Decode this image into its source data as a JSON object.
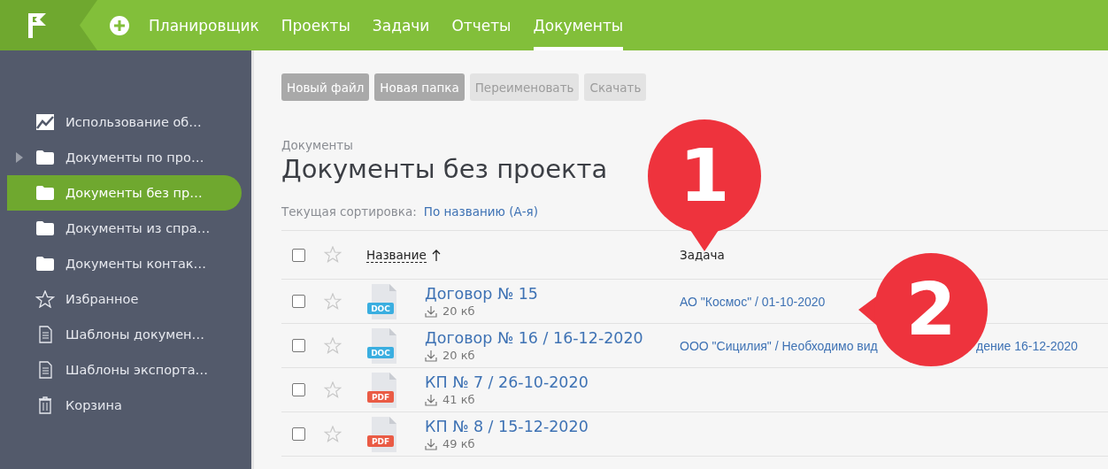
{
  "nav": {
    "items": [
      {
        "label": "Планировщик",
        "selected": false
      },
      {
        "label": "Проекты",
        "selected": false
      },
      {
        "label": "Задачи",
        "selected": false
      },
      {
        "label": "Отчеты",
        "selected": false
      },
      {
        "label": "Документы",
        "selected": true
      }
    ]
  },
  "sidebar": {
    "items": [
      {
        "kind": "chart",
        "label": "Использование об…",
        "selected": false,
        "expandable": false
      },
      {
        "kind": "folder",
        "label": "Документы по про…",
        "selected": false,
        "expandable": true
      },
      {
        "kind": "folder",
        "label": "Документы без пр…",
        "selected": true,
        "expandable": false
      },
      {
        "kind": "folder",
        "label": "Документы из спра…",
        "selected": false,
        "expandable": false
      },
      {
        "kind": "folder",
        "label": "Документы контак…",
        "selected": false,
        "expandable": false
      },
      {
        "kind": "star",
        "label": "Избранное",
        "selected": false,
        "expandable": false
      },
      {
        "kind": "document",
        "label": "Шаблоны докумен…",
        "selected": false,
        "expandable": false
      },
      {
        "kind": "document",
        "label": "Шаблоны экспорта…",
        "selected": false,
        "expandable": false
      },
      {
        "kind": "trash",
        "label": "Корзина",
        "selected": false,
        "expandable": false
      }
    ]
  },
  "toolbar": {
    "buttons": [
      {
        "label": "Новый файл",
        "disabled": false
      },
      {
        "label": "Новая папка",
        "disabled": false
      },
      {
        "label": "Переименовать",
        "disabled": true
      },
      {
        "label": "Скачать",
        "disabled": true
      }
    ]
  },
  "breadcrumb": "Документы",
  "title": "Документы без проекта",
  "sort": {
    "label": "Текущая сортировка:",
    "value": "По названию (А-я)"
  },
  "table": {
    "select_all_checked": false,
    "columns": [
      {
        "label": "Название",
        "sorted": true
      },
      {
        "label": "Задача",
        "sorted": false
      }
    ],
    "rows": [
      {
        "checked": false,
        "starred": false,
        "file_type": "DOC",
        "name": "Договор № 15",
        "size": "20 кб",
        "task": "АО \"Космос\" / 01-10-2020"
      },
      {
        "checked": false,
        "starred": false,
        "file_type": "DOC",
        "name": "Договор № 16 / 16-12-2020",
        "size": "20 кб",
        "task": "ООО \"Сицилия\" / Необходимо вид",
        "task_tail": "дение 16-12-2020"
      },
      {
        "checked": false,
        "starred": false,
        "file_type": "PDF",
        "name": "КП № 7 / 26-10-2020",
        "size": "41 кб"
      },
      {
        "checked": false,
        "starred": false,
        "file_type": "PDF",
        "name": "КП № 8 / 15-12-2020",
        "size": "49 кб"
      }
    ]
  },
  "callouts": [
    {
      "number": "1"
    },
    {
      "number": "2"
    }
  ]
}
